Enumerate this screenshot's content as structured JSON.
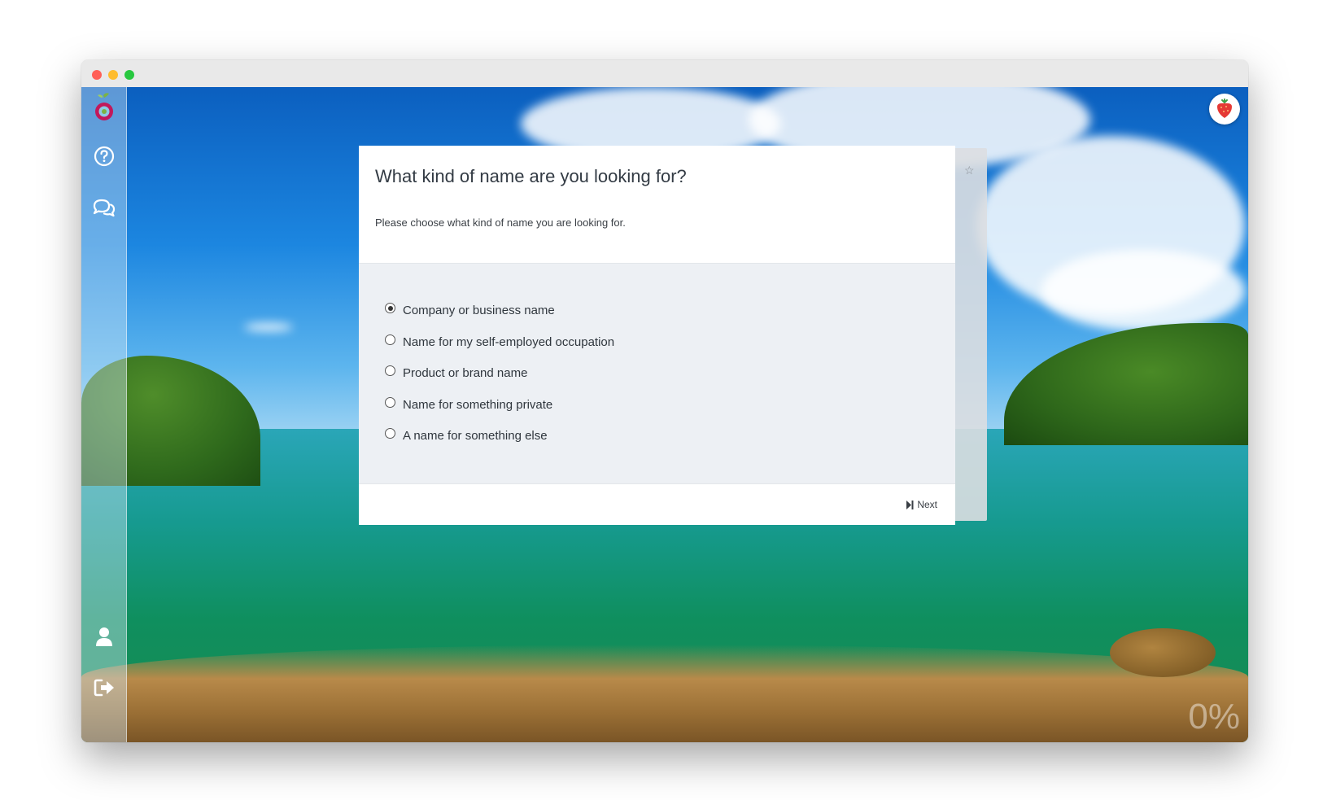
{
  "window": {
    "traffic_lights": [
      "close",
      "minimize",
      "maximize"
    ]
  },
  "sidebar": {
    "items": [
      {
        "name": "logo",
        "icon": "fruit-logo-icon"
      },
      {
        "name": "help",
        "icon": "help-circle-icon"
      },
      {
        "name": "chat",
        "icon": "chat-bubbles-icon"
      },
      {
        "name": "profile",
        "icon": "user-icon"
      },
      {
        "name": "logout",
        "icon": "logout-icon"
      }
    ]
  },
  "header": {
    "avatar_icon": "strawberry-avatar-icon"
  },
  "survey": {
    "title": "What kind of name are you looking for?",
    "description": "Please choose what kind of name you are looking for.",
    "options": [
      {
        "label": "Company or business name",
        "selected": true
      },
      {
        "label": "Name for my self-employed occupation",
        "selected": false
      },
      {
        "label": "Product or brand name",
        "selected": false
      },
      {
        "label": "Name for something private",
        "selected": false
      },
      {
        "label": "A name for something else",
        "selected": false
      }
    ],
    "next_label": "Next",
    "bookmark_icon": "star-icon"
  },
  "progress": {
    "label": "0%",
    "value": 0
  },
  "colors": {
    "radio_checked": "#333333",
    "title_text": "#333b44",
    "close": "#ff5f57",
    "minimize": "#febc2e",
    "maximize": "#28c840"
  }
}
